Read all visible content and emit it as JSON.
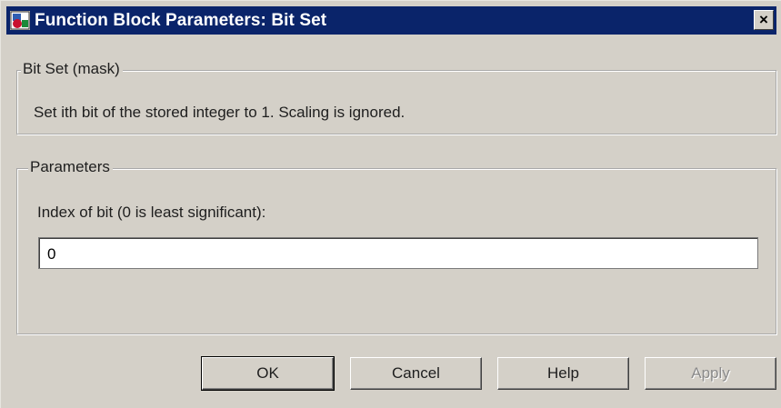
{
  "window": {
    "title": "Function Block Parameters: Bit Set",
    "close_glyph": "×",
    "app_icon": "simulink-block-icon",
    "close_icon": "close-icon"
  },
  "mask_group": {
    "legend": "Bit Set (mask)",
    "description": "Set ith bit of the stored integer to 1.  Scaling is ignored."
  },
  "parameters_group": {
    "legend": "Parameters",
    "index_label": "Index of bit (0 is least significant):",
    "index_value": "0"
  },
  "buttons": {
    "ok": "OK",
    "cancel": "Cancel",
    "help": "Help",
    "apply": "Apply"
  },
  "colors": {
    "titlebar": "#0a246a",
    "dialog_face": "#d4d0c8",
    "disabled_text": "#8a8a8a"
  }
}
